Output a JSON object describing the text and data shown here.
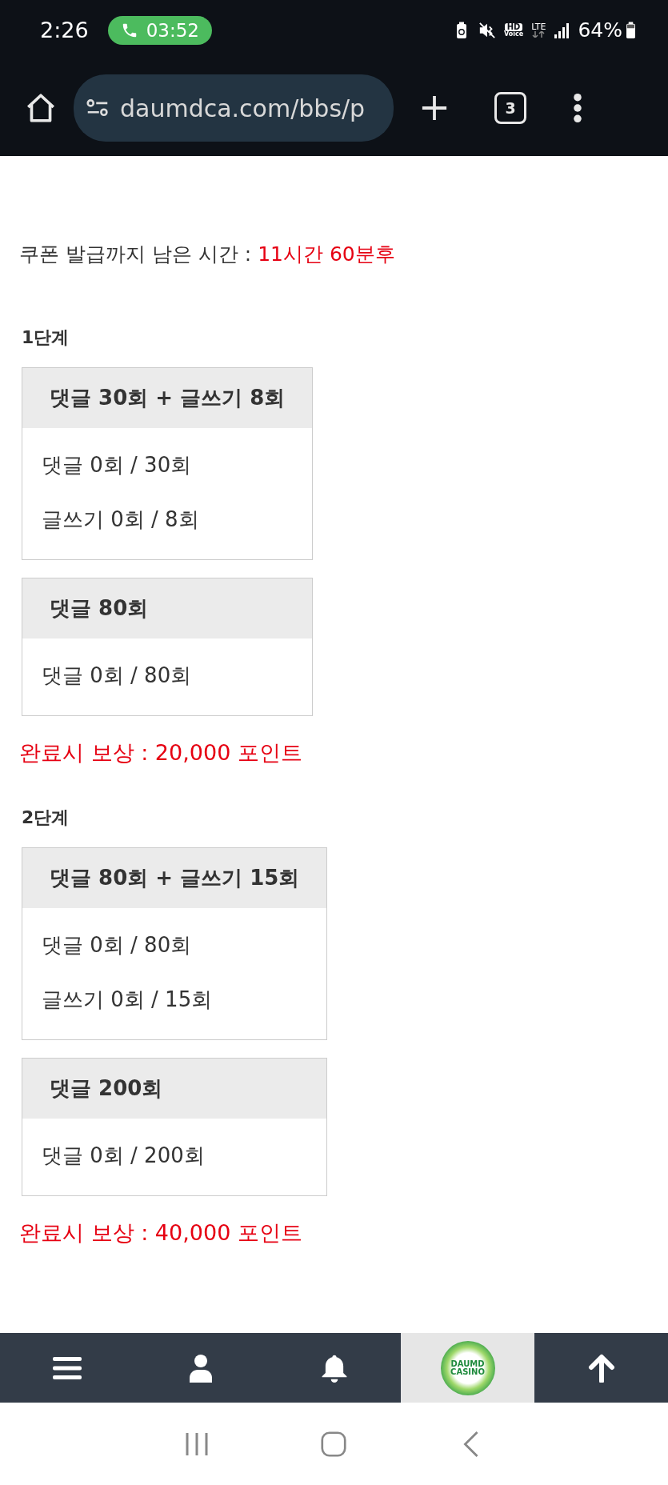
{
  "status_bar": {
    "time": "2:26",
    "call_timer": "03:52",
    "hd_label": "HD",
    "voice_label": "Voice",
    "network_label": "LTE",
    "battery": "64%"
  },
  "browser": {
    "url": "daumdca.com/bbs/p",
    "tab_count": "3"
  },
  "countdown": {
    "label": "쿠폰 발급까지 남은 시간 :",
    "value": "11시간 60분후"
  },
  "stages": [
    {
      "title": "1단계",
      "missions": [
        {
          "title": "댓글 30회 + 글쓰기 8회",
          "progress": [
            "댓글 0회 / 30회",
            "글쓰기 0회 / 8회"
          ]
        },
        {
          "title": "댓글 80회",
          "progress": [
            "댓글 0회 / 80회"
          ]
        }
      ],
      "reward": "완료시 보상 : 20,000 포인트"
    },
    {
      "title": "2단계",
      "missions": [
        {
          "title": "댓글 80회 + 글쓰기 15회",
          "progress": [
            "댓글 0회 / 80회",
            "글쓰기 0회 / 15회"
          ]
        },
        {
          "title": "댓글 200회",
          "progress": [
            "댓글 0회 / 200회"
          ]
        }
      ],
      "reward": "완료시 보상 : 40,000 포인트"
    }
  ],
  "bottom_nav": {
    "logo_lines": [
      "DAUMD",
      "CASINO"
    ]
  }
}
